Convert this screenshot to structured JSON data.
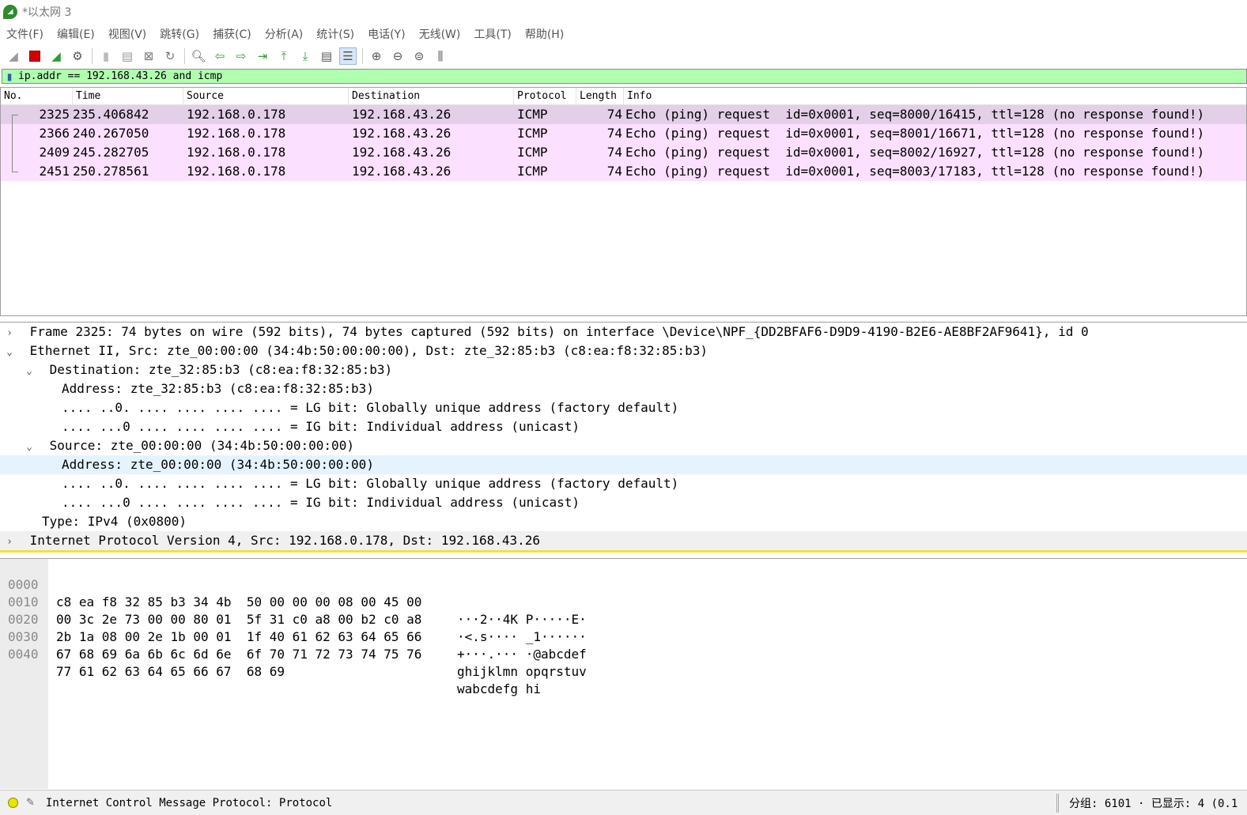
{
  "window": {
    "title": "*以太网 3"
  },
  "menu": [
    "文件(F)",
    "编辑(E)",
    "视图(V)",
    "跳转(G)",
    "捕获(C)",
    "分析(A)",
    "统计(S)",
    "电话(Y)",
    "无线(W)",
    "工具(T)",
    "帮助(H)"
  ],
  "filter": {
    "value": "ip.addr == 192.168.43.26 and icmp"
  },
  "packet_list": {
    "columns": [
      "No.",
      "Time",
      "Source",
      "Destination",
      "Protocol",
      "Length",
      "Info"
    ],
    "rows": [
      {
        "no": "2325",
        "time": "235.406842",
        "source": "192.168.0.178",
        "destination": "192.168.43.26",
        "protocol": "ICMP",
        "length": "74",
        "info": "Echo (ping) request  id=0x0001, seq=8000/16415, ttl=128 (no response found!)"
      },
      {
        "no": "2366",
        "time": "240.267050",
        "source": "192.168.0.178",
        "destination": "192.168.43.26",
        "protocol": "ICMP",
        "length": "74",
        "info": "Echo (ping) request  id=0x0001, seq=8001/16671, ttl=128 (no response found!)"
      },
      {
        "no": "2409",
        "time": "245.282705",
        "source": "192.168.0.178",
        "destination": "192.168.43.26",
        "protocol": "ICMP",
        "length": "74",
        "info": "Echo (ping) request  id=0x0001, seq=8002/16927, ttl=128 (no response found!)"
      },
      {
        "no": "2451",
        "time": "250.278561",
        "source": "192.168.0.178",
        "destination": "192.168.43.26",
        "protocol": "ICMP",
        "length": "74",
        "info": "Echo (ping) request  id=0x0001, seq=8003/17183, ttl=128 (no response found!)"
      }
    ]
  },
  "details": [
    {
      "text": "Frame 2325: 74 bytes on wire (592 bits), 74 bytes captured (592 bits) on interface \\Device\\NPF_{DD2BFAF6-D9D9-4190-B2E6-AE8BF2AF9641}, id 0",
      "arrow": "›"
    },
    {
      "text": "Ethernet II, Src: zte_00:00:00 (34:4b:50:00:00:00), Dst: zte_32:85:b3 (c8:ea:f8:32:85:b3)",
      "arrow": "⌄"
    },
    {
      "text": "Destination: zte_32:85:b3 (c8:ea:f8:32:85:b3)",
      "arrow": "⌄"
    },
    {
      "text": "Address: zte_32:85:b3 (c8:ea:f8:32:85:b3)"
    },
    {
      "text": ".... ..0. .... .... .... .... = LG bit: Globally unique address (factory default)"
    },
    {
      "text": ".... ...0 .... .... .... .... = IG bit: Individual address (unicast)"
    },
    {
      "text": "Source: zte_00:00:00 (34:4b:50:00:00:00)",
      "arrow": "⌄"
    },
    {
      "text": "Address: zte_00:00:00 (34:4b:50:00:00:00)"
    },
    {
      "text": ".... ..0. .... .... .... .... = LG bit: Globally unique address (factory default)"
    },
    {
      "text": ".... ...0 .... .... .... .... = IG bit: Individual address (unicast)"
    },
    {
      "text": "Type: IPv4 (0x0800)"
    },
    {
      "text": "Internet Protocol Version 4, Src: 192.168.0.178, Dst: 192.168.43.26",
      "arrow": "›"
    }
  ],
  "bytes": [
    {
      "offset": "0000",
      "hex": "c8 ea f8 32 85 b3 34 4b  50 00 00 00 08 00 45 00",
      "ascii": "···2··4K P·····E·"
    },
    {
      "offset": "0010",
      "hex": "00 3c 2e 73 00 00 80 01  5f 31 c0 a8 00 b2 c0 a8",
      "ascii": "·<.s···· _1······"
    },
    {
      "offset": "0020",
      "hex": "2b 1a 08 00 2e 1b 00 01  1f 40 61 62 63 64 65 66",
      "ascii": "+···.··· ·@abcdef"
    },
    {
      "offset": "0030",
      "hex": "67 68 69 6a 6b 6c 6d 6e  6f 70 71 72 73 74 75 76",
      "ascii": "ghijklmn opqrstuv"
    },
    {
      "offset": "0040",
      "hex": "77 61 62 63 64 65 66 67  68 69",
      "ascii": "wabcdefg hi"
    }
  ],
  "status": {
    "text": "Internet Control Message Protocol: Protocol",
    "packets": "分组: 6101 · 已显示: 4 (0.1"
  }
}
